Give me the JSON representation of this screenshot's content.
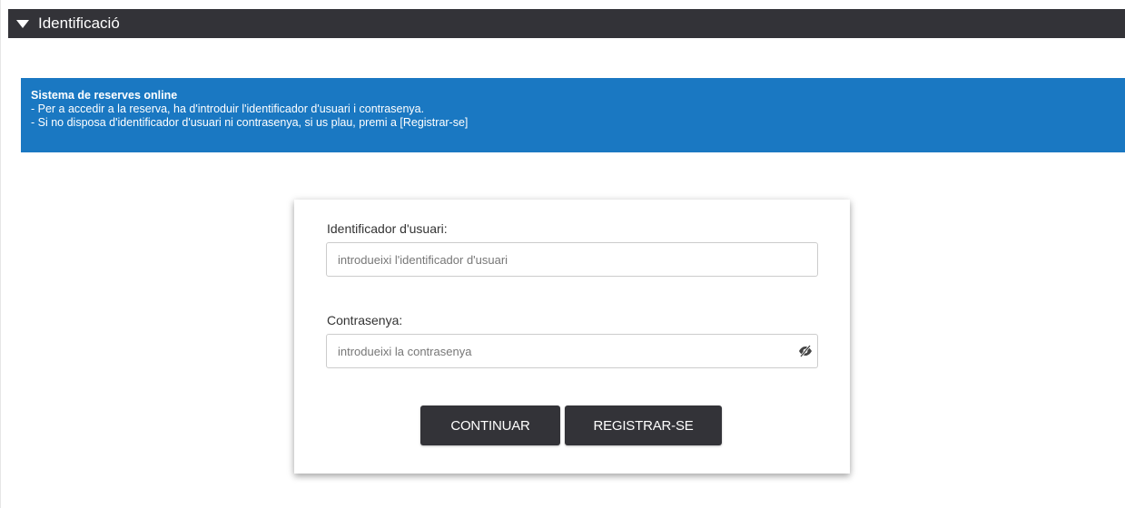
{
  "section": {
    "title": "Identificació"
  },
  "info": {
    "title": "Sistema de reserves online",
    "lines": [
      "- Per a accedir a la reserva, ha d'introduir l'identificador d'usuari i contrasenya.",
      "- Si no disposa d'identificador d'usuari ni contrasenya, si us plau, premi a [Registrar-se]"
    ]
  },
  "login": {
    "user_label": "Identificador d'usuari:",
    "user_placeholder": "introdueixi l'identificador d'usuari",
    "password_label": "Contrasenya:",
    "password_placeholder": "introdueixi la contrasenya",
    "password_toggle_icon": "eye-slash-icon",
    "continue_label": "CONTINUAR",
    "register_label": "REGISTRAR-SE"
  },
  "colors": {
    "header_bg": "#333338",
    "info_bg": "#1a78c2",
    "button_bg": "#333338"
  }
}
